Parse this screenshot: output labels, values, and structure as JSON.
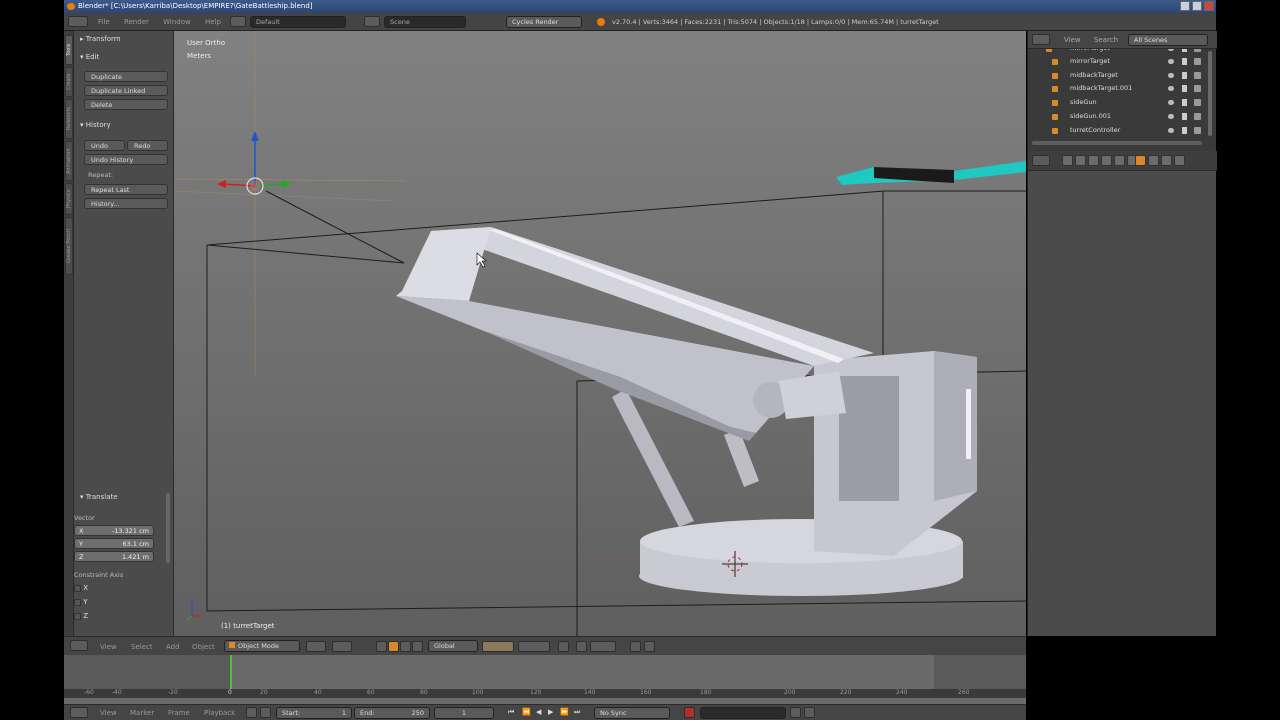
{
  "window": {
    "title": "Blender* [C:\\Users\\Karriba\\Desktop\\EMPIRE?\\GateBattleship.blend]"
  },
  "infobar": {
    "menus": [
      "File",
      "Render",
      "Window",
      "Help"
    ],
    "screen_layout": "Default",
    "scene": "Scene",
    "render_engine": "Cycles Render",
    "stats": "v2.70.4 | Verts:3464 | Faces:2231 | Tris:5074 | Objects:1/18 | Lamps:0/0 | Mem:65.74M | turretTarget"
  },
  "toolshelf": {
    "tabs": [
      "Tools",
      "Create",
      "Relations",
      "Animation",
      "Physics",
      "Grease Pencil"
    ],
    "transform_header": "Transform",
    "edit_header": "Edit",
    "edit_buttons": [
      "Duplicate",
      "Duplicate Linked",
      "Delete"
    ],
    "history_header": "History",
    "undo_label": "Undo",
    "redo_label": "Redo",
    "undo_history_label": "Undo History",
    "repeat_label": "Repeat:",
    "repeat_last_label": "Repeat Last",
    "history_ellipsis_label": "History...",
    "translate_header": "Translate",
    "vector_label": "Vector",
    "vector": [
      {
        "axis": "X",
        "value": "-13.321 cm"
      },
      {
        "axis": "Y",
        "value": "63.1 cm"
      },
      {
        "axis": "Z",
        "value": "1.421 m"
      }
    ],
    "constraint_label": "Constraint Axis",
    "constraint_axes": [
      "X",
      "Y",
      "Z"
    ]
  },
  "viewport": {
    "view_name": "User Ortho",
    "units": "Meters",
    "object_label": "(1) turretTarget"
  },
  "outliner": {
    "view_label": "View",
    "search_label": "Search",
    "filter": "All Scenes",
    "rows": [
      "mirrorTarget",
      "mirrorTarget",
      "midbackTarget",
      "midbackTarget.001",
      "sideGun",
      "sideGun.001",
      "turretController"
    ]
  },
  "view3d_header": {
    "menus": [
      "View",
      "Select",
      "Add",
      "Object"
    ],
    "mode": "Object Mode",
    "orientation": "Global"
  },
  "timeline": {
    "tick_labels": [
      "-60",
      "-40",
      "-20",
      "0",
      "20",
      "40",
      "60",
      "80",
      "100",
      "120",
      "140",
      "160",
      "180",
      "200",
      "220",
      "240",
      "260"
    ],
    "current_frame": 1
  },
  "timeline_header": {
    "menus": [
      "View",
      "Marker",
      "Frame",
      "Playback"
    ],
    "start_label": "Start:",
    "start_value": "1",
    "end_label": "End:",
    "end_value": "250",
    "current_value": "1",
    "sync": "No Sync"
  },
  "colors": {
    "accent_orange": "#d88a2a",
    "selected_teal": "#1fc8c0",
    "gizmo_z": "#2255cc",
    "gizmo_x": "#cc2222",
    "gizmo_y": "#22aa22"
  }
}
